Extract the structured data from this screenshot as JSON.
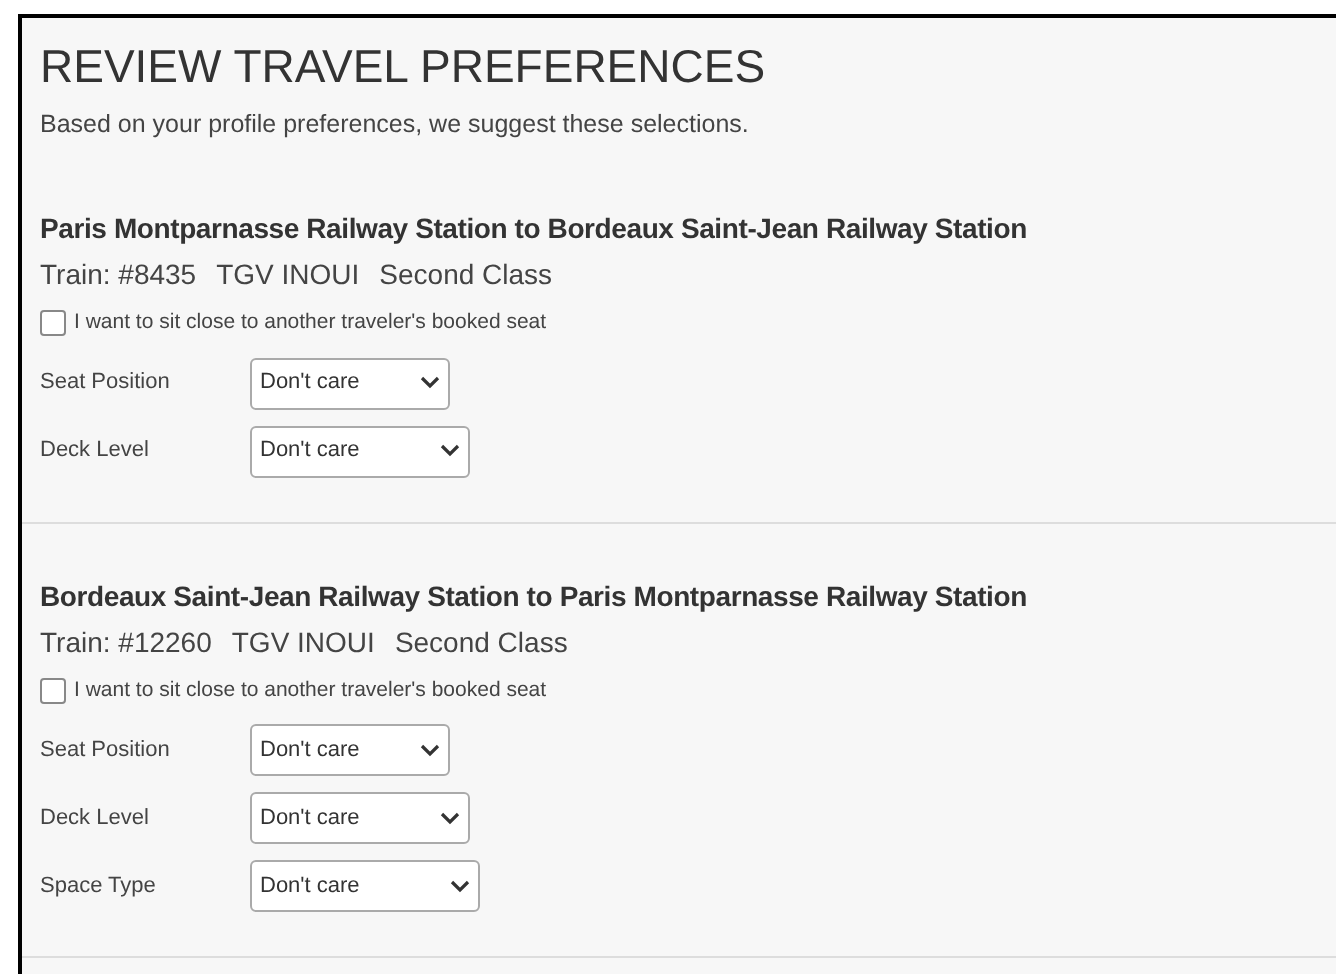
{
  "title": "REVIEW TRAVEL PREFERENCES",
  "intro": "Based on your profile preferences, we suggest these selections.",
  "segments": [
    {
      "route": "Paris Montparnasse Railway Station to Bordeaux Saint-Jean Railway Station",
      "train": "Train: #8435",
      "service": "TGV INOUI",
      "class": "Second Class",
      "sit_close": {
        "label": "I want to sit close to another traveler's booked seat",
        "checked": false
      },
      "fields": [
        {
          "label": "Seat Position",
          "value": "Don't care"
        },
        {
          "label": "Deck Level",
          "value": "Don't care"
        }
      ]
    },
    {
      "route": "Bordeaux Saint-Jean Railway Station to Paris Montparnasse Railway Station",
      "train": "Train: #12260",
      "service": "TGV INOUI",
      "class": "Second Class",
      "sit_close": {
        "label": "I want to sit close to another traveler's booked seat",
        "checked": false
      },
      "fields": [
        {
          "label": "Seat Position",
          "value": "Don't care"
        },
        {
          "label": "Deck Level",
          "value": "Don't care"
        },
        {
          "label": "Space Type",
          "value": "Don't care"
        }
      ]
    }
  ]
}
